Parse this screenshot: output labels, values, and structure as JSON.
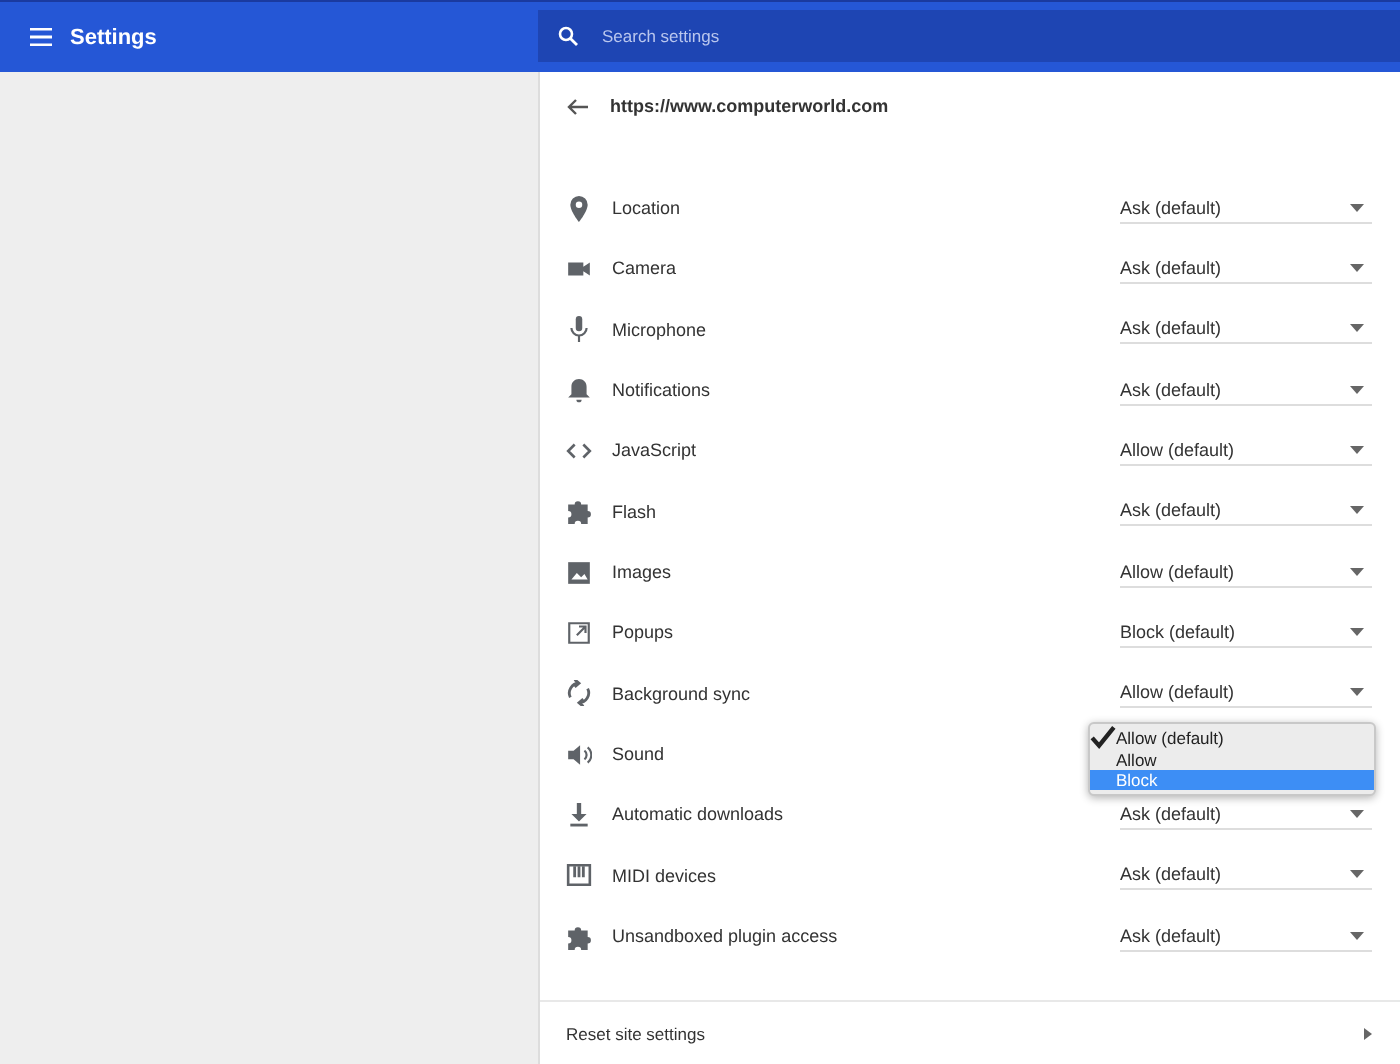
{
  "header": {
    "title": "Settings",
    "search": {
      "placeholder": "Search settings"
    }
  },
  "site": {
    "url": "https://www.computerworld.com"
  },
  "permissions": [
    {
      "kind": "location",
      "label": "Location",
      "value": "Ask (default)"
    },
    {
      "kind": "camera",
      "label": "Camera",
      "value": "Ask (default)"
    },
    {
      "kind": "microphone",
      "label": "Microphone",
      "value": "Ask (default)"
    },
    {
      "kind": "bell",
      "label": "Notifications",
      "value": "Ask (default)"
    },
    {
      "kind": "code",
      "label": "JavaScript",
      "value": "Allow (default)"
    },
    {
      "kind": "puzzle",
      "label": "Flash",
      "value": "Ask (default)"
    },
    {
      "kind": "image",
      "label": "Images",
      "value": "Allow (default)"
    },
    {
      "kind": "popup",
      "label": "Popups",
      "value": "Block (default)"
    },
    {
      "kind": "sync",
      "label": "Background sync",
      "value": "Allow (default)"
    },
    {
      "kind": "speaker",
      "label": "Sound",
      "menu": [
        {
          "label": "Allow (default)",
          "checked": true,
          "selected": false
        },
        {
          "label": "Allow",
          "checked": false,
          "selected": false
        },
        {
          "label": "Block",
          "checked": false,
          "selected": true
        }
      ]
    },
    {
      "kind": "download",
      "label": "Automatic downloads",
      "value": "Ask (default)"
    },
    {
      "kind": "midi",
      "label": "MIDI devices",
      "value": "Ask (default)"
    },
    {
      "kind": "puzzle",
      "label": "Unsandboxed plugin access",
      "value": "Ask (default)"
    }
  ],
  "reset": {
    "label": "Reset site settings"
  }
}
